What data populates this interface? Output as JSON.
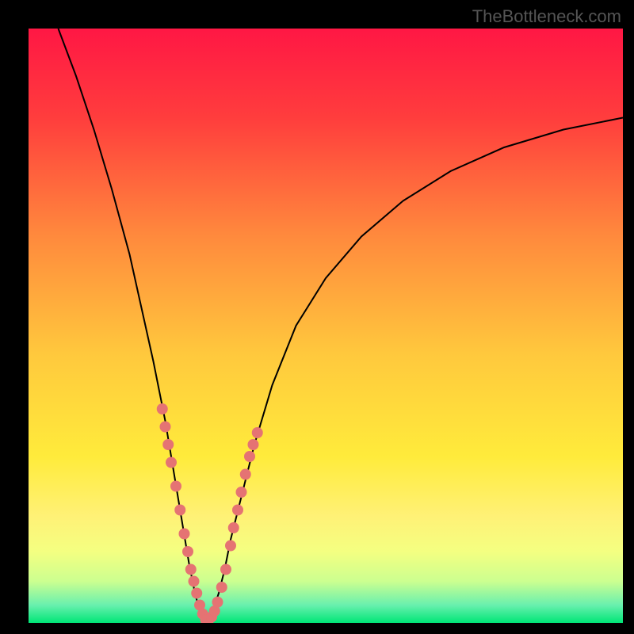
{
  "watermark": "TheBottleneck.com",
  "chart_data": {
    "type": "line",
    "title": "",
    "xlabel": "",
    "ylabel": "",
    "xlim": [
      0,
      100
    ],
    "ylim": [
      0,
      100
    ],
    "background_gradient": {
      "stops": [
        {
          "offset": 0,
          "color": "#ff1744"
        },
        {
          "offset": 0.15,
          "color": "#ff3d3d"
        },
        {
          "offset": 0.35,
          "color": "#ff8a3d"
        },
        {
          "offset": 0.55,
          "color": "#ffc93d"
        },
        {
          "offset": 0.72,
          "color": "#ffeb3b"
        },
        {
          "offset": 0.82,
          "color": "#fff176"
        },
        {
          "offset": 0.88,
          "color": "#f4ff81"
        },
        {
          "offset": 0.93,
          "color": "#ccff90"
        },
        {
          "offset": 0.97,
          "color": "#69f0ae"
        },
        {
          "offset": 1.0,
          "color": "#00e676"
        }
      ]
    },
    "series": [
      {
        "name": "bottleneck-curve",
        "color": "#000000",
        "stroke_width": 2,
        "x": [
          5,
          8,
          11,
          14,
          17,
          19,
          21,
          23,
          24.5,
          26,
          27,
          28,
          28.8,
          29.5,
          30,
          30.5,
          31,
          32,
          33,
          34,
          36,
          38,
          41,
          45,
          50,
          56,
          63,
          71,
          80,
          90,
          100
        ],
        "y": [
          100,
          92,
          83,
          73,
          62,
          53,
          44,
          34,
          25,
          16,
          10,
          5,
          2,
          0.5,
          0,
          0.5,
          2,
          5,
          9,
          14,
          22,
          30,
          40,
          50,
          58,
          65,
          71,
          76,
          80,
          83,
          85
        ]
      }
    ],
    "scatter_overlay": {
      "name": "data-points",
      "color": "#e57373",
      "radius": 7,
      "points": [
        {
          "x": 22.5,
          "y": 36
        },
        {
          "x": 23.0,
          "y": 33
        },
        {
          "x": 23.5,
          "y": 30
        },
        {
          "x": 24.0,
          "y": 27
        },
        {
          "x": 24.8,
          "y": 23
        },
        {
          "x": 25.5,
          "y": 19
        },
        {
          "x": 26.2,
          "y": 15
        },
        {
          "x": 26.8,
          "y": 12
        },
        {
          "x": 27.3,
          "y": 9
        },
        {
          "x": 27.8,
          "y": 7
        },
        {
          "x": 28.3,
          "y": 5
        },
        {
          "x": 28.8,
          "y": 3
        },
        {
          "x": 29.3,
          "y": 1.5
        },
        {
          "x": 29.8,
          "y": 0.5
        },
        {
          "x": 30.2,
          "y": 0.3
        },
        {
          "x": 30.8,
          "y": 1
        },
        {
          "x": 31.3,
          "y": 2
        },
        {
          "x": 31.8,
          "y": 3.5
        },
        {
          "x": 32.5,
          "y": 6
        },
        {
          "x": 33.2,
          "y": 9
        },
        {
          "x": 34.0,
          "y": 13
        },
        {
          "x": 34.5,
          "y": 16
        },
        {
          "x": 35.2,
          "y": 19
        },
        {
          "x": 35.8,
          "y": 22
        },
        {
          "x": 36.5,
          "y": 25
        },
        {
          "x": 37.2,
          "y": 28
        },
        {
          "x": 37.8,
          "y": 30
        },
        {
          "x": 38.5,
          "y": 32
        }
      ]
    }
  }
}
